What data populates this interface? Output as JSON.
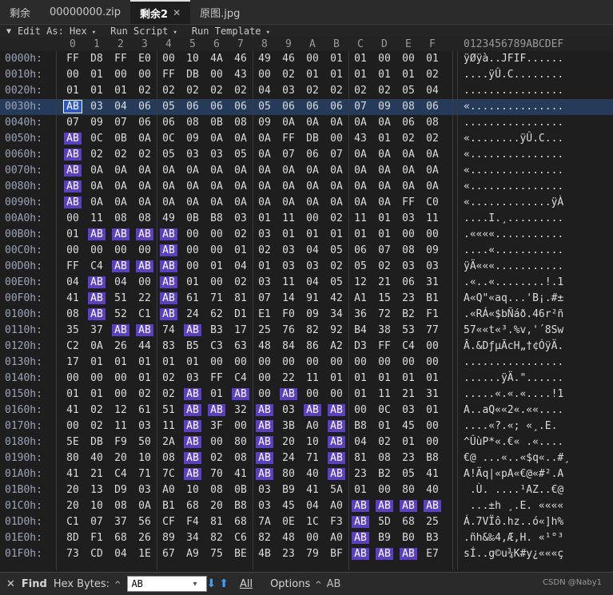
{
  "tabs": [
    {
      "label": "剩余",
      "active": false
    },
    {
      "label": "00000000.zip",
      "active": false
    },
    {
      "label": "剩余2",
      "active": true
    },
    {
      "label": "原图.jpg",
      "active": false
    }
  ],
  "toolbar": {
    "edit_as": "Edit As: Hex",
    "run_script": "Run Script",
    "run_template": "Run Template"
  },
  "columns": [
    "0",
    "1",
    "2",
    "3",
    "4",
    "5",
    "6",
    "7",
    "8",
    "9",
    "A",
    "B",
    "C",
    "D",
    "E",
    "F"
  ],
  "ascii_header": "0123456789ABCDEF",
  "rows": [
    {
      "addr": "0000h:",
      "bytes": [
        "FF",
        "D8",
        "FF",
        "E0",
        "00",
        "10",
        "4A",
        "46",
        "49",
        "46",
        "00",
        "01",
        "01",
        "00",
        "00",
        "01"
      ],
      "ascii": "ÿØÿà..JFIF......"
    },
    {
      "addr": "0010h:",
      "bytes": [
        "00",
        "01",
        "00",
        "00",
        "FF",
        "DB",
        "00",
        "43",
        "00",
        "02",
        "01",
        "01",
        "01",
        "01",
        "01",
        "02"
      ],
      "ascii": "....ÿÛ.C........"
    },
    {
      "addr": "0020h:",
      "bytes": [
        "01",
        "01",
        "01",
        "02",
        "02",
        "02",
        "02",
        "02",
        "04",
        "03",
        "02",
        "02",
        "02",
        "02",
        "05",
        "04"
      ],
      "ascii": "................"
    },
    {
      "addr": "0030h:",
      "bytes": [
        "AB",
        "03",
        "04",
        "06",
        "05",
        "06",
        "06",
        "06",
        "05",
        "06",
        "06",
        "06",
        "07",
        "09",
        "08",
        "06"
      ],
      "ascii": "«..............."
    },
    {
      "addr": "0040h:",
      "bytes": [
        "07",
        "09",
        "07",
        "06",
        "06",
        "08",
        "0B",
        "08",
        "09",
        "0A",
        "0A",
        "0A",
        "0A",
        "0A",
        "06",
        "08"
      ],
      "ascii": "................"
    },
    {
      "addr": "0050h:",
      "bytes": [
        "AB",
        "0C",
        "0B",
        "0A",
        "0C",
        "09",
        "0A",
        "0A",
        "0A",
        "FF",
        "DB",
        "00",
        "43",
        "01",
        "02",
        "02"
      ],
      "ascii": "«........ÿÛ.C..."
    },
    {
      "addr": "0060h:",
      "bytes": [
        "AB",
        "02",
        "02",
        "02",
        "05",
        "03",
        "03",
        "05",
        "0A",
        "07",
        "06",
        "07",
        "0A",
        "0A",
        "0A",
        "0A"
      ],
      "ascii": "«..............."
    },
    {
      "addr": "0070h:",
      "bytes": [
        "AB",
        "0A",
        "0A",
        "0A",
        "0A",
        "0A",
        "0A",
        "0A",
        "0A",
        "0A",
        "0A",
        "0A",
        "0A",
        "0A",
        "0A",
        "0A"
      ],
      "ascii": "«..............."
    },
    {
      "addr": "0080h:",
      "bytes": [
        "AB",
        "0A",
        "0A",
        "0A",
        "0A",
        "0A",
        "0A",
        "0A",
        "0A",
        "0A",
        "0A",
        "0A",
        "0A",
        "0A",
        "0A",
        "0A"
      ],
      "ascii": "«..............."
    },
    {
      "addr": "0090h:",
      "bytes": [
        "AB",
        "0A",
        "0A",
        "0A",
        "0A",
        "0A",
        "0A",
        "0A",
        "0A",
        "0A",
        "0A",
        "0A",
        "0A",
        "0A",
        "FF",
        "C0"
      ],
      "ascii": "«.............ÿÀ"
    },
    {
      "addr": "00A0h:",
      "bytes": [
        "00",
        "11",
        "08",
        "08",
        "49",
        "0B",
        "B8",
        "03",
        "01",
        "11",
        "00",
        "02",
        "11",
        "01",
        "03",
        "11"
      ],
      "ascii": "....I.¸........."
    },
    {
      "addr": "00B0h:",
      "bytes": [
        "01",
        "AB",
        "AB",
        "AB",
        "AB",
        "00",
        "00",
        "02",
        "03",
        "01",
        "01",
        "01",
        "01",
        "01",
        "00",
        "00"
      ],
      "ascii": ".««««..........."
    },
    {
      "addr": "00C0h:",
      "bytes": [
        "00",
        "00",
        "00",
        "00",
        "AB",
        "00",
        "00",
        "01",
        "02",
        "03",
        "04",
        "05",
        "06",
        "07",
        "08",
        "09"
      ],
      "ascii": "....«..........."
    },
    {
      "addr": "00D0h:",
      "bytes": [
        "FF",
        "C4",
        "AB",
        "AB",
        "AB",
        "00",
        "01",
        "04",
        "01",
        "03",
        "03",
        "02",
        "05",
        "02",
        "03",
        "03"
      ],
      "ascii": "ÿÄ«««..........."
    },
    {
      "addr": "00E0h:",
      "bytes": [
        "04",
        "AB",
        "04",
        "00",
        "AB",
        "01",
        "00",
        "02",
        "03",
        "11",
        "04",
        "05",
        "12",
        "21",
        "06",
        "31"
      ],
      "ascii": ".«..«........!.1"
    },
    {
      "addr": "00F0h:",
      "bytes": [
        "41",
        "AB",
        "51",
        "22",
        "AB",
        "61",
        "71",
        "81",
        "07",
        "14",
        "91",
        "42",
        "A1",
        "15",
        "23",
        "B1"
      ],
      "ascii": "A«Q\"«aq...'B¡.#±"
    },
    {
      "addr": "0100h:",
      "bytes": [
        "08",
        "AB",
        "52",
        "C1",
        "AB",
        "24",
        "62",
        "D1",
        "E1",
        "F0",
        "09",
        "34",
        "36",
        "72",
        "B2",
        "F1"
      ],
      "ascii": ".«RÁ«$bÑáð.46r²ñ"
    },
    {
      "addr": "0110h:",
      "bytes": [
        "35",
        "37",
        "AB",
        "AB",
        "74",
        "AB",
        "B3",
        "17",
        "25",
        "76",
        "82",
        "92",
        "B4",
        "38",
        "53",
        "77"
      ],
      "ascii": "57««t«³.%v,'´8Sw"
    },
    {
      "addr": "0120h:",
      "bytes": [
        "C2",
        "0A",
        "26",
        "44",
        "83",
        "B5",
        "C3",
        "63",
        "48",
        "84",
        "86",
        "A2",
        "D3",
        "FF",
        "C4",
        "00"
      ],
      "ascii": "Â.&DƒµÃcH„†¢ÓÿÄ."
    },
    {
      "addr": "0130h:",
      "bytes": [
        "17",
        "01",
        "01",
        "01",
        "01",
        "01",
        "00",
        "00",
        "00",
        "00",
        "00",
        "00",
        "00",
        "00",
        "00",
        "00"
      ],
      "ascii": "................"
    },
    {
      "addr": "0140h:",
      "bytes": [
        "00",
        "00",
        "00",
        "01",
        "02",
        "03",
        "FF",
        "C4",
        "00",
        "22",
        "11",
        "01",
        "01",
        "01",
        "01",
        "01"
      ],
      "ascii": "......ÿÄ.\"......"
    },
    {
      "addr": "0150h:",
      "bytes": [
        "01",
        "01",
        "00",
        "02",
        "02",
        "AB",
        "01",
        "AB",
        "00",
        "AB",
        "00",
        "00",
        "01",
        "11",
        "21",
        "31"
      ],
      "ascii": ".....«.«.«....!1"
    },
    {
      "addr": "0160h:",
      "bytes": [
        "41",
        "02",
        "12",
        "61",
        "51",
        "AB",
        "AB",
        "32",
        "AB",
        "03",
        "AB",
        "AB",
        "00",
        "0C",
        "03",
        "01"
      ],
      "ascii": "A..aQ««2«.««...."
    },
    {
      "addr": "0170h:",
      "bytes": [
        "00",
        "02",
        "11",
        "03",
        "11",
        "AB",
        "3F",
        "00",
        "AB",
        "3B",
        "A0",
        "AB",
        "B8",
        "01",
        "45",
        "00"
      ],
      "ascii": "....«?.«; «¸.E."
    },
    {
      "addr": "0180h:",
      "bytes": [
        "5E",
        "DB",
        "F9",
        "50",
        "2A",
        "AB",
        "00",
        "80",
        "AB",
        "20",
        "10",
        "AB",
        "04",
        "02",
        "01",
        "00"
      ],
      "ascii": "^ÛùP*«.€« .«...."
    },
    {
      "addr": "0190h:",
      "bytes": [
        "80",
        "40",
        "20",
        "10",
        "08",
        "AB",
        "02",
        "08",
        "AB",
        "24",
        "71",
        "AB",
        "81",
        "08",
        "23",
        "B8"
      ],
      "ascii": "€@ ...«..«$q«..#¸"
    },
    {
      "addr": "01A0h:",
      "bytes": [
        "41",
        "21",
        "C4",
        "71",
        "7C",
        "AB",
        "70",
        "41",
        "AB",
        "80",
        "40",
        "AB",
        "23",
        "B2",
        "05",
        "41"
      ],
      "ascii": "A!Äq|«pA«€@«#².A"
    },
    {
      "addr": "01B0h:",
      "bytes": [
        "20",
        "13",
        "D9",
        "03",
        "A0",
        "10",
        "08",
        "0B",
        "03",
        "B9",
        "41",
        "5A",
        "01",
        "00",
        "80",
        "40"
      ],
      "ascii": " .Ù. ....¹AZ..€@"
    },
    {
      "addr": "01C0h:",
      "bytes": [
        "20",
        "10",
        "08",
        "0A",
        "B1",
        "68",
        "20",
        "B8",
        "03",
        "45",
        "04",
        "A0",
        "AB",
        "AB",
        "AB",
        "AB"
      ],
      "ascii": " ...±h ¸.E. ««««"
    },
    {
      "addr": "01D0h:",
      "bytes": [
        "C1",
        "07",
        "37",
        "56",
        "CF",
        "F4",
        "81",
        "68",
        "7A",
        "0E",
        "1C",
        "F3",
        "AB",
        "5D",
        "68",
        "25"
      ],
      "ascii": "Á.7VÏô.hz..ó«]h%"
    },
    {
      "addr": "01E0h:",
      "bytes": [
        "8D",
        "F1",
        "68",
        "26",
        "89",
        "34",
        "82",
        "C6",
        "82",
        "48",
        "00",
        "A0",
        "AB",
        "B9",
        "B0",
        "B3"
      ],
      "ascii": ".ñh&‰4‚Æ‚H. «¹°³"
    },
    {
      "addr": "01F0h:",
      "bytes": [
        "73",
        "CD",
        "04",
        "1E",
        "67",
        "A9",
        "75",
        "BE",
        "4B",
        "23",
        "79",
        "BF",
        "AB",
        "AB",
        "AB",
        "E7"
      ],
      "ascii": "sÍ..g©u¾K#y¿«««ç"
    }
  ],
  "find": {
    "label": "Find",
    "mode": "Hex Bytes:",
    "query": "AB",
    "all": "All",
    "options": "Options",
    "result_text": "AB"
  },
  "watermark": "CSDN @Naby1"
}
